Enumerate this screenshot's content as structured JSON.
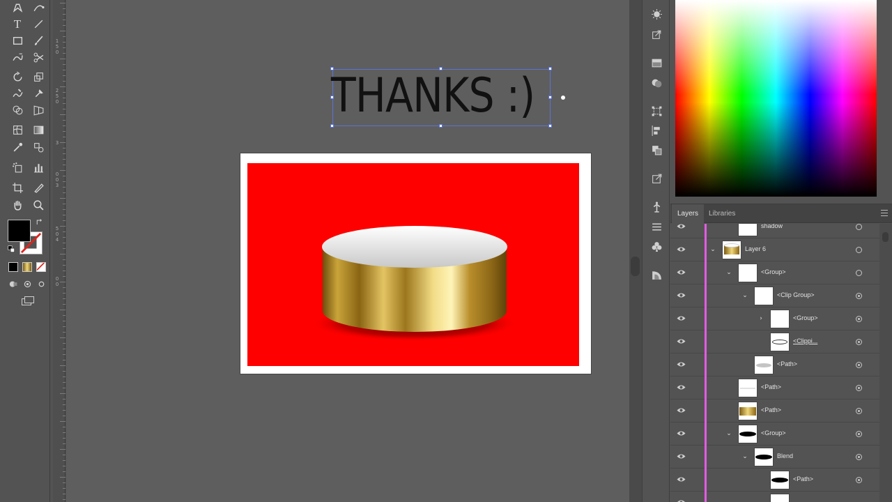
{
  "app": {
    "tools": [
      {
        "id": "pen",
        "name": "pen-tool-icon"
      },
      {
        "id": "curvature",
        "name": "curvature-tool-icon"
      },
      {
        "id": "type",
        "name": "type-tool-icon",
        "glyph": "T"
      },
      {
        "id": "line",
        "name": "line-segment-tool-icon"
      },
      {
        "id": "rect",
        "name": "rectangle-tool-icon"
      },
      {
        "id": "brush",
        "name": "paintbrush-tool-icon"
      },
      {
        "id": "shaper",
        "name": "shaper-tool-icon"
      },
      {
        "id": "scissors",
        "name": "scissors-tool-icon"
      },
      {
        "id": "rotate",
        "name": "rotate-tool-icon"
      },
      {
        "id": "scale",
        "name": "scale-tool-icon"
      },
      {
        "id": "warp",
        "name": "warp-tool-icon"
      },
      {
        "id": "puppet",
        "name": "puppet-warp-tool-icon"
      },
      {
        "id": "shapebuilder",
        "name": "shape-builder-tool-icon"
      },
      {
        "id": "perspective",
        "name": "perspective-grid-tool-icon"
      },
      {
        "id": "mesh",
        "name": "mesh-tool-icon"
      },
      {
        "id": "gradient",
        "name": "gradient-tool-icon"
      },
      {
        "id": "eyedropper",
        "name": "eyedropper-tool-icon"
      },
      {
        "id": "blend",
        "name": "blend-tool-icon"
      },
      {
        "id": "symbol",
        "name": "symbol-sprayer-tool-icon"
      },
      {
        "id": "graph",
        "name": "column-graph-tool-icon"
      },
      {
        "id": "artboard",
        "name": "artboard-tool-icon"
      },
      {
        "id": "slice",
        "name": "slice-tool-icon"
      },
      {
        "id": "hand",
        "name": "hand-tool-icon"
      },
      {
        "id": "zoom",
        "name": "zoom-tool-icon"
      }
    ],
    "fill_color": "#000000",
    "stroke_color": "none"
  },
  "ruler": {
    "numbers": [
      "1",
      "5",
      "0",
      "2",
      "5",
      "0",
      "3",
      "0",
      "0",
      "3",
      "5",
      "0",
      "4",
      "0",
      "0"
    ]
  },
  "canvas": {
    "headline": "THANKS :)",
    "background_color": "#ff0000",
    "coin_gold": "#d4af37"
  },
  "panels": {
    "layers_tab": "Layers",
    "libraries_tab": "Libraries",
    "layers": [
      {
        "name": "shadow",
        "indent": 1,
        "twisty": "",
        "thumb": "white",
        "target": "empty"
      },
      {
        "name": "Layer 6",
        "indent": 0,
        "twisty": "⌄",
        "thumb": "gold",
        "target": "empty"
      },
      {
        "name": "<Group>",
        "indent": 1,
        "twisty": "⌄",
        "thumb": "white",
        "target": "empty"
      },
      {
        "name": "<Clip Group>",
        "indent": 2,
        "twisty": "⌄",
        "thumb": "white",
        "target": "filled"
      },
      {
        "name": "<Group>",
        "indent": 3,
        "twisty": "›",
        "thumb": "white",
        "target": "filled"
      },
      {
        "name": "<Clippi...",
        "indent": 3,
        "twisty": "",
        "thumb": "ellipse-outline",
        "target": "filled",
        "underline": true
      },
      {
        "name": "<Path>",
        "indent": 2,
        "twisty": "",
        "thumb": "grey-ellipse",
        "target": "filled"
      },
      {
        "name": "<Path>",
        "indent": 1,
        "twisty": "",
        "thumb": "white-line",
        "target": "filled"
      },
      {
        "name": "<Path>",
        "indent": 1,
        "twisty": "",
        "thumb": "gold-band",
        "target": "filled"
      },
      {
        "name": "<Group>",
        "indent": 1,
        "twisty": "⌄",
        "thumb": "black-ellipse",
        "target": "filled"
      },
      {
        "name": "Blend",
        "indent": 2,
        "twisty": "⌄",
        "thumb": "black-ellipse",
        "target": "filled"
      },
      {
        "name": "<Path>",
        "indent": 3,
        "twisty": "",
        "thumb": "black-ellipse",
        "target": "filled"
      },
      {
        "name": "",
        "indent": 3,
        "twisty": "",
        "thumb": "white",
        "target": "none"
      }
    ],
    "layer_color": "#e55be5"
  }
}
